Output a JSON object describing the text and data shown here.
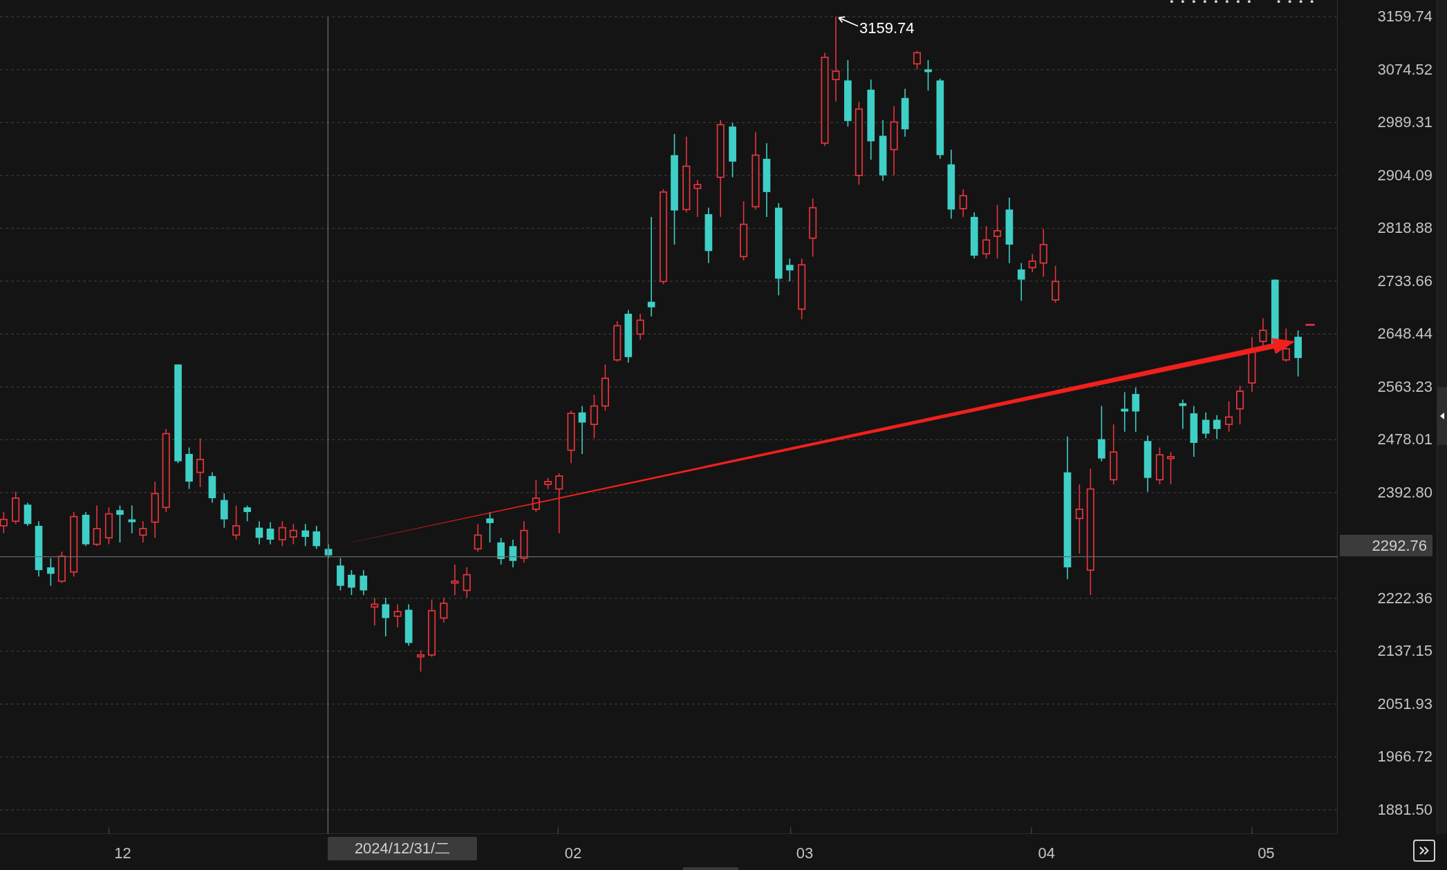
{
  "chart": {
    "high_annotation": "3159.74",
    "price_axis": [
      "3159.74",
      "3074.52",
      "2989.31",
      "2904.09",
      "2818.88",
      "2733.66",
      "2648.44",
      "2563.23",
      "2478.01",
      "2392.80",
      "2222.36",
      "2137.15",
      "2051.93",
      "1966.72",
      "1881.50"
    ],
    "time_axis": [
      "12",
      "02",
      "03",
      "04",
      "05"
    ],
    "crosshair": {
      "price": "2292.76",
      "date": "2024/12/31/二"
    }
  }
}
